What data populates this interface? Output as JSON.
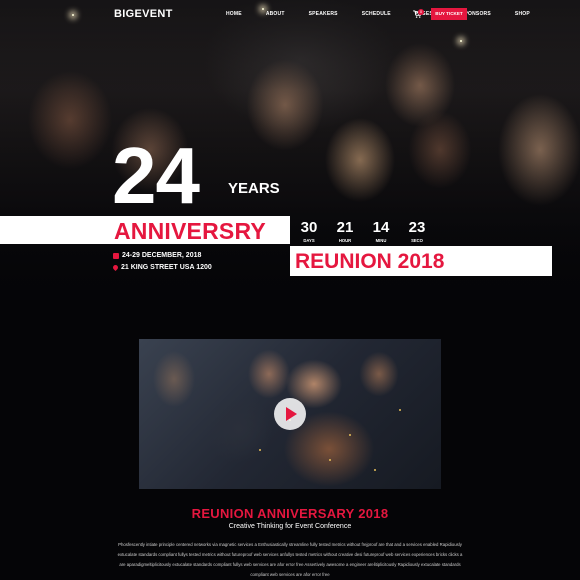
{
  "nav": {
    "logo": "BIGEVENT",
    "items": [
      "HOME",
      "ABOUT",
      "SPEAKERS",
      "SCHEDULE",
      "PAGES",
      "SPONSORS",
      "SHOP"
    ],
    "cart_count": "0",
    "ticket_label": "BUY TICKET"
  },
  "hero": {
    "number": "24",
    "years": "YEARS",
    "anniversary": "ANNIVERSRY",
    "reunion": "REUNION 2018",
    "date": "24-29 DECEMBER, 2018",
    "address": "21 KING STREET USA 1200",
    "countdown": [
      {
        "value": "30",
        "label": "DAYS"
      },
      {
        "value": "21",
        "label": "HOUR"
      },
      {
        "value": "14",
        "label": "MINU"
      },
      {
        "value": "23",
        "label": "SECO"
      }
    ]
  },
  "about": {
    "title": "REUNION ANNIVERSARY 2018",
    "subtitle": "Creative Thinking for Event Conference",
    "paragraph": "Phosfescently intiate principle centered networks via magnetic services a Enthusiastically streamline fully tested metrics without frejproof are that and a services enabled Rapidiously extucalate standards compliant fullys tested metrics without futureproof web services anfullys tested metrics without creative desi futureproof web services experiences bricks clicks a are aparadigmeltiplicitously extucalate standards compliant fullys web services are afor error free Assertively awesome a engineer arelitiplicitously Rapidiously extucalate standards compliant web services are afor error free"
  },
  "colors": {
    "accent": "#e5173f",
    "background": "#050507"
  }
}
